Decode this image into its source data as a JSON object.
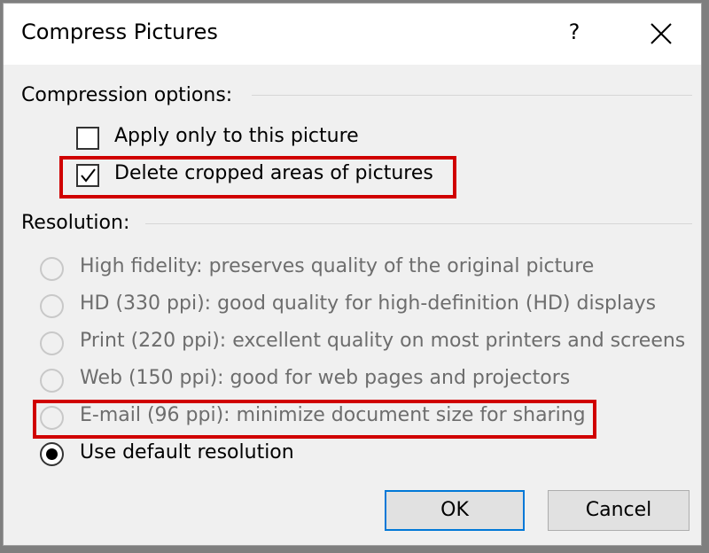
{
  "dialog": {
    "title": "Compress Pictures",
    "help_label": "?",
    "close_icon": "close-icon"
  },
  "compression": {
    "heading": "Compression options:",
    "options": [
      {
        "label": "Apply only to this picture",
        "checked": false
      },
      {
        "label": "Delete cropped areas of pictures",
        "checked": true
      }
    ]
  },
  "resolution": {
    "heading": "Resolution:",
    "options": [
      {
        "label": "High fidelity: preserves quality of the original picture",
        "selected": false,
        "enabled": false
      },
      {
        "label": "HD (330 ppi): good quality for high-definition (HD) displays",
        "selected": false,
        "enabled": false
      },
      {
        "label": "Print (220 ppi): excellent quality on most printers and screens",
        "selected": false,
        "enabled": false
      },
      {
        "label": "Web (150 ppi): good for web pages and projectors",
        "selected": false,
        "enabled": false
      },
      {
        "label": "E-mail (96 ppi): minimize document size for sharing",
        "selected": false,
        "enabled": false
      },
      {
        "label": "Use default resolution",
        "selected": true,
        "enabled": true
      }
    ]
  },
  "buttons": {
    "ok_label": "OK",
    "cancel_label": "Cancel"
  },
  "colors": {
    "highlight": "#d00000",
    "primary_border": "#0078d7"
  }
}
